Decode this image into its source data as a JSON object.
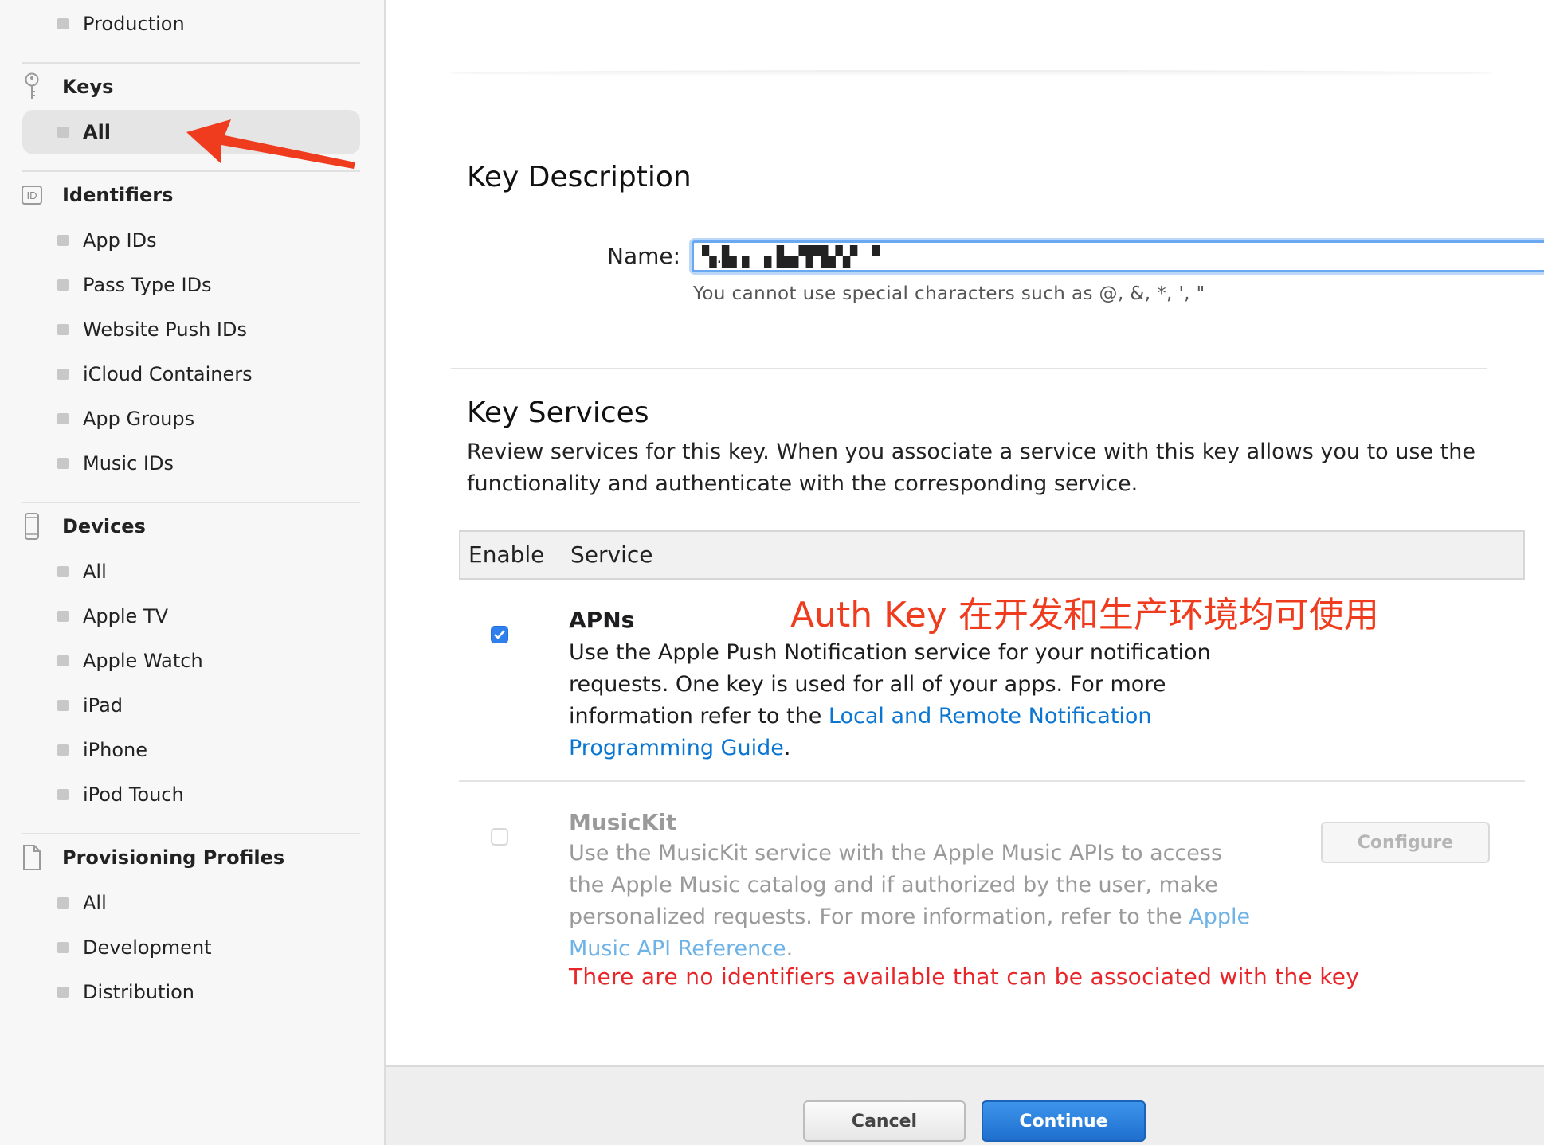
{
  "sidebar": {
    "top_items": [
      "Production"
    ],
    "keys": {
      "title": "Keys",
      "items": [
        "All"
      ],
      "selected": "All"
    },
    "identifiers": {
      "title": "Identifiers",
      "icon_text": "ID",
      "items": [
        "App IDs",
        "Pass Type IDs",
        "Website Push IDs",
        "iCloud Containers",
        "App Groups",
        "Music IDs"
      ]
    },
    "devices": {
      "title": "Devices",
      "items": [
        "All",
        "Apple TV",
        "Apple Watch",
        "iPad",
        "iPhone",
        "iPod Touch"
      ]
    },
    "profiles": {
      "title": "Provisioning Profiles",
      "items": [
        "All",
        "Development",
        "Distribution"
      ]
    }
  },
  "key_description": {
    "title": "Key Description",
    "name_label": "Name:",
    "name_value": "▚.▙ ▖▗ ▙▞▛▙▚▘▝",
    "hint": "You cannot use special characters such as @, &, *, ', \""
  },
  "key_services": {
    "title": "Key Services",
    "description": "Review services for this key. When you associate a service with this key allows you to use the functionality and authenticate with the corresponding service.",
    "table_headers": {
      "enable": "Enable",
      "service": "Service"
    },
    "apns": {
      "name": "APNs",
      "checked": true,
      "desc_before": "Use the Apple Push Notification service for your notification requests. One key is used for all of your apps. For more information refer to the ",
      "link": "Local and Remote Notification Programming Guide",
      "desc_after": "."
    },
    "musickit": {
      "name": "MusicKit",
      "checked": false,
      "desc_before": "Use the MusicKit service with the Apple Music APIs to access the Apple Music catalog and if authorized by the user, make personalized requests. For more information, refer to the ",
      "link": "Apple Music API Reference",
      "desc_after": ".",
      "warning": "There are no identifiers available that can be associated with the key",
      "configure_label": "Configure"
    }
  },
  "annotation": "Auth Key 在开发和生产环境均可使用",
  "footer": {
    "cancel_label": "Cancel",
    "continue_label": "Continue"
  },
  "colors": {
    "link": "#0b76d1",
    "primary_button": "#2477da",
    "warning": "#e8262a",
    "annotation": "#f03c1e",
    "checkbox": "#2f80ed"
  },
  "icons": {
    "keys": "key-icon",
    "identifiers": "id-badge-icon",
    "devices": "phone-icon",
    "profiles": "document-icon",
    "checkmark": "checkmark-icon",
    "arrow": "red-arrow-annotation"
  }
}
